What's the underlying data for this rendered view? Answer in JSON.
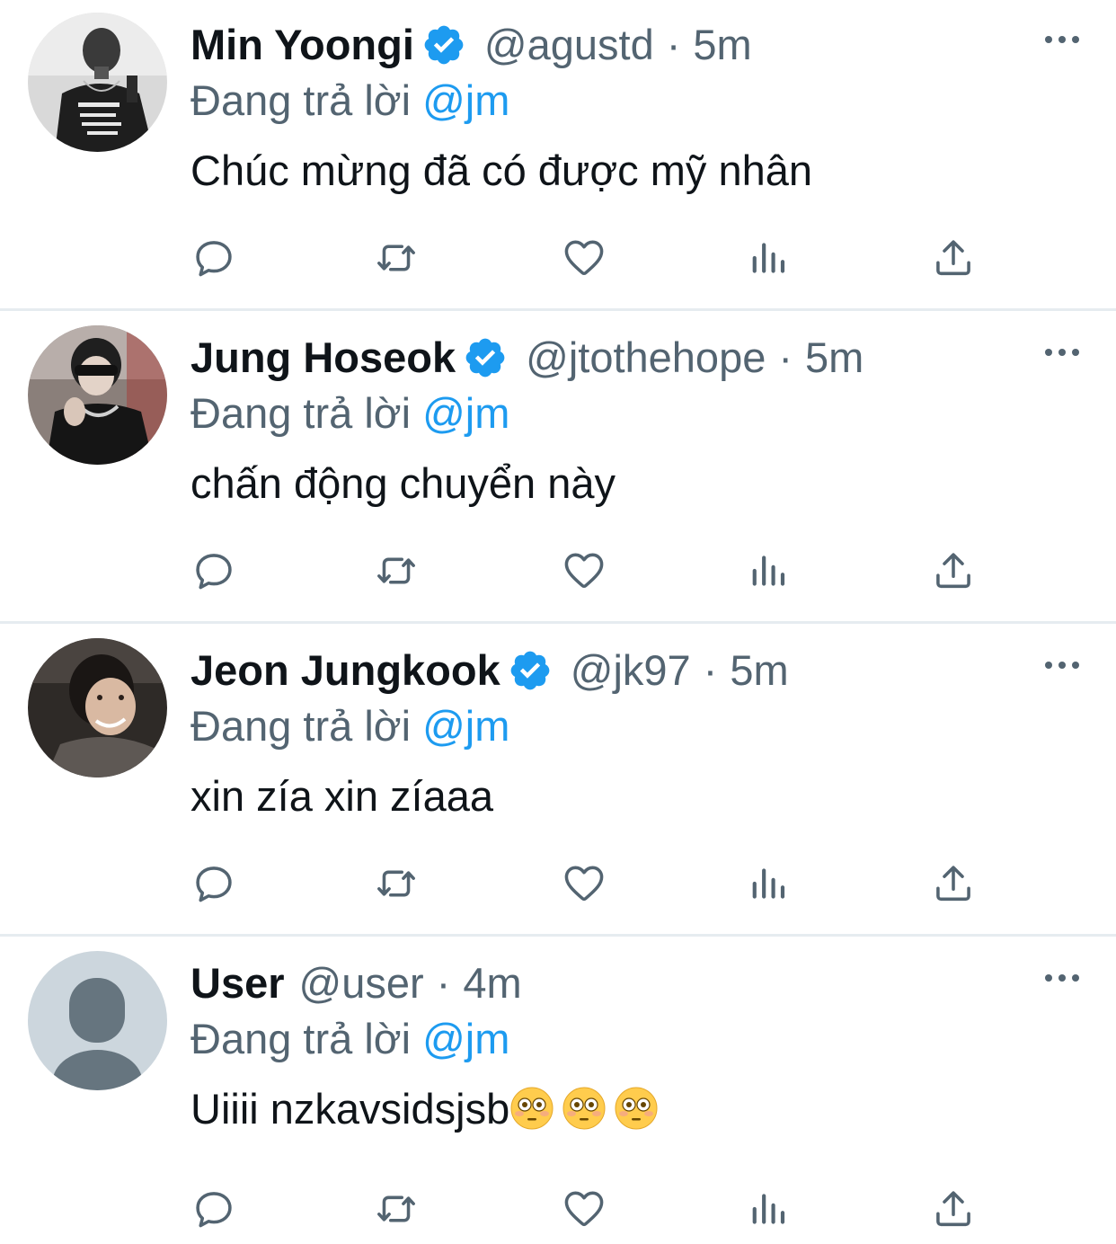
{
  "colors": {
    "accent": "#1d9bf0",
    "text": "#0f1419",
    "secondary": "#536471",
    "divider": "#e6ecf0"
  },
  "icons": {
    "verified": "verified-badge-icon",
    "more": "more-options-icon",
    "reply": "reply-icon",
    "retweet": "retweet-icon",
    "like": "heart-icon",
    "views": "views-icon",
    "share": "share-icon",
    "emoji": "flushed-face-emoji"
  },
  "tweets": [
    {
      "name": "Min Yoongi",
      "verified": true,
      "handle": "@agustd",
      "separator": "·",
      "time": "5m",
      "reply_label": "Đang trả lời",
      "reply_to": "@jm",
      "text": "Chúc mừng đã có được mỹ nhân"
    },
    {
      "name": "Jung Hoseok",
      "verified": true,
      "handle": "@jtothehope",
      "separator": "·",
      "time": "5m",
      "reply_label": "Đang trả lời",
      "reply_to": "@jm",
      "text": "chấn động chuyển này"
    },
    {
      "name": "Jeon Jungkook",
      "verified": true,
      "handle": "@jk97",
      "separator": "·",
      "time": "5m",
      "reply_label": "Đang trả lời",
      "reply_to": "@jm",
      "text": "xin zía xin zíaaa"
    },
    {
      "name": "User",
      "verified": false,
      "handle": "@user",
      "separator": "·",
      "time": "4m",
      "reply_label": "Đang trả lời",
      "reply_to": "@jm",
      "text": "Uiiii nzkavsidsjsb",
      "emoji_count": 3
    }
  ]
}
